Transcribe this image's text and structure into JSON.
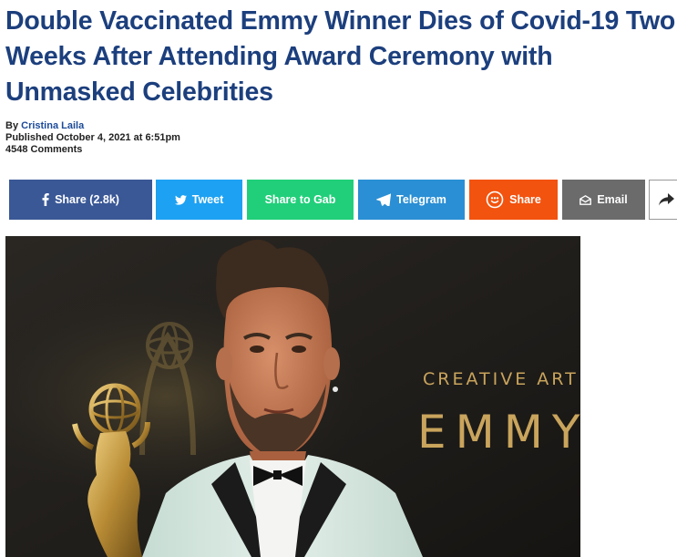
{
  "article": {
    "title": "Double Vaccinated Emmy Winner Dies of Covid-19 Two Weeks After Attending Award Ceremony with Unmasked Celebrities",
    "byline_prefix": "By",
    "author": "Cristina Laila",
    "published": "Published October 4, 2021 at 6:51pm",
    "comments": "4548 Comments"
  },
  "share": {
    "facebook": "Share (2.8k)",
    "twitter": "Tweet",
    "gab": "Share to Gab",
    "telegram": "Telegram",
    "mewe": "Share",
    "email": "Email"
  },
  "photo": {
    "backdrop_line1": "CREATIVE ART",
    "backdrop_line2": "EMMYS"
  },
  "colors": {
    "headline": "#1c3f7d",
    "author_link": "#1c4a98",
    "facebook": "#3a5896",
    "twitter": "#1da1f2",
    "gab": "#21cf7a",
    "telegram": "#2a8fd4",
    "mewe": "#f2530f",
    "email": "#6b6b6b",
    "backdrop_text": "#c9a45c"
  }
}
